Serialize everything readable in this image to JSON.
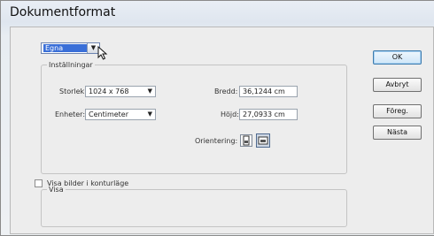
{
  "window": {
    "title": "Dokumentformat"
  },
  "preset": {
    "value": "Egna"
  },
  "settings": {
    "legend": "Inställningar",
    "size_label": "Storlek:",
    "size_value": "1024 x 768",
    "units_label": "Enheter:",
    "units_value": "Centimeter",
    "width_label": "Bredd:",
    "width_value": "36,1244 cm",
    "height_label": "Höjd:",
    "height_value": "27,0933 cm",
    "orientation_label": "Orientering:"
  },
  "view": {
    "legend": "Visa",
    "checkbox_label": "Visa bilder i konturläge",
    "checkbox_checked": false
  },
  "buttons": {
    "ok": "OK",
    "cancel": "Avbryt",
    "prev": "Föreg.",
    "next": "Nästa"
  },
  "icons": {
    "dropdown": "chevron-down-icon",
    "cursor": "mouse-pointer-icon",
    "portrait": "portrait-orientation-icon",
    "landscape": "landscape-orientation-icon"
  }
}
